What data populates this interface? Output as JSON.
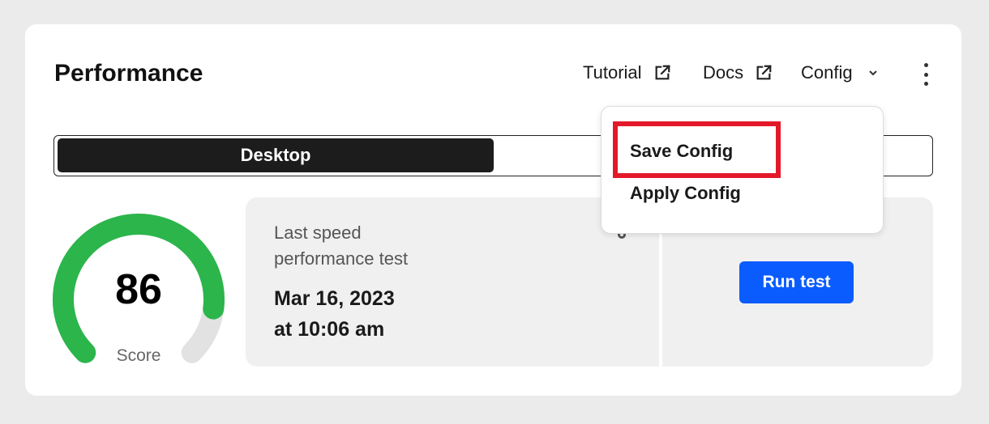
{
  "header": {
    "title": "Performance",
    "links": {
      "tutorial": "Tutorial",
      "docs": "Docs",
      "config": "Config"
    }
  },
  "view_toggle": {
    "active": "Desktop",
    "other": ""
  },
  "score": {
    "value": "86",
    "label": "Score",
    "fraction": 0.86,
    "color": "#2bb54b",
    "track_color": "#e2e2e2"
  },
  "last_test": {
    "label": "Last speed performance test",
    "date": "Mar 16, 2023",
    "time": "at 10:06 am"
  },
  "actions": {
    "run_test": "Run test",
    "run_color": "#0a5cff"
  },
  "config_menu": {
    "items": [
      "Save Config",
      "Apply Config"
    ],
    "highlighted": "Save Config",
    "highlight_color": "#e3192a"
  },
  "icons": [
    "external-link-icon",
    "chevron-down-icon",
    "more-vertical-icon",
    "gear-icon"
  ]
}
